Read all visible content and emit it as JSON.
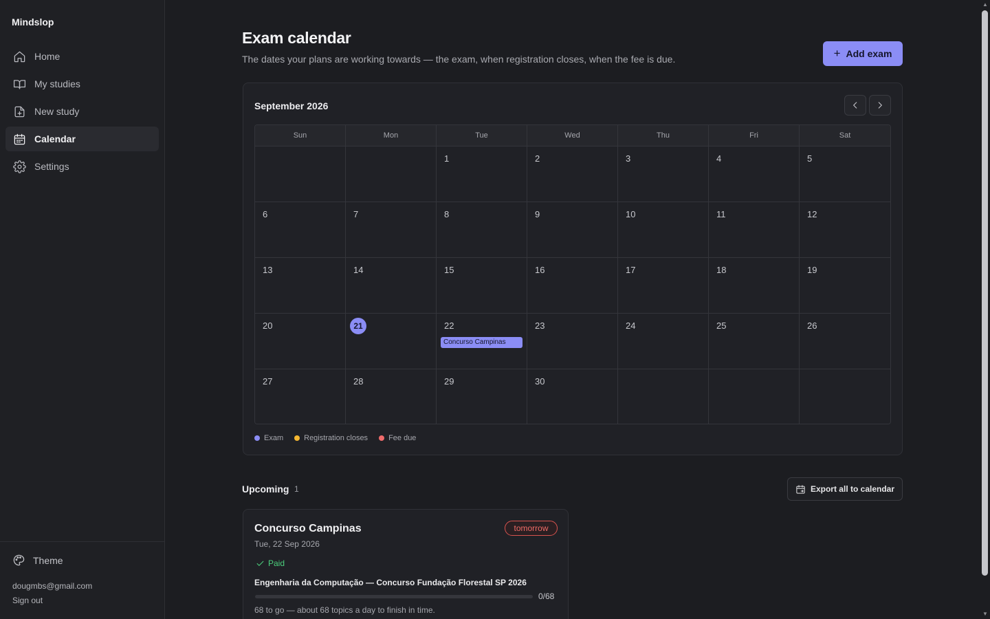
{
  "app": {
    "brand": "Mindslop"
  },
  "sidebar": {
    "items": [
      {
        "label": "Home",
        "icon": "home-icon",
        "active": false
      },
      {
        "label": "My studies",
        "icon": "book-icon",
        "active": false
      },
      {
        "label": "New study",
        "icon": "file-plus-icon",
        "active": false
      },
      {
        "label": "Calendar",
        "icon": "calendar-icon",
        "active": true
      },
      {
        "label": "Settings",
        "icon": "gear-icon",
        "active": false
      }
    ],
    "theme_label": "Theme",
    "user_email": "dougmbs@gmail.com",
    "sign_out": "Sign out"
  },
  "header": {
    "title": "Exam calendar",
    "subtitle": "The dates your plans are working towards — the exam, when registration closes, when the fee is due.",
    "add_button": "Add exam"
  },
  "calendar": {
    "month_label": "September 2026",
    "weekdays": [
      "Sun",
      "Mon",
      "Tue",
      "Wed",
      "Thu",
      "Fri",
      "Sat"
    ],
    "weeks": [
      [
        "",
        "",
        "1",
        "2",
        "3",
        "4",
        "5"
      ],
      [
        "6",
        "7",
        "8",
        "9",
        "10",
        "11",
        "12"
      ],
      [
        "13",
        "14",
        "15",
        "16",
        "17",
        "18",
        "19"
      ],
      [
        "20",
        "21",
        "22",
        "23",
        "24",
        "25",
        "26"
      ],
      [
        "27",
        "28",
        "29",
        "30",
        "",
        "",
        ""
      ]
    ],
    "today": "21",
    "events": [
      {
        "day": "22",
        "label": "Concurso Campinas",
        "kind": "exam"
      }
    ],
    "legend": [
      {
        "label": "Exam",
        "color": "#8b8df5"
      },
      {
        "label": "Registration closes",
        "color": "#f5b731"
      },
      {
        "label": "Fee due",
        "color": "#ef6b6b"
      }
    ]
  },
  "upcoming": {
    "title": "Upcoming",
    "count": "1",
    "export_button": "Export all to calendar",
    "items": [
      {
        "name": "Concurso Campinas",
        "badge": "tomorrow",
        "date": "Tue, 22 Sep 2026",
        "status": "Paid",
        "study": "Engenharia da Computação — Concurso Fundação Florestal SP 2026",
        "progress_text": "0/68",
        "progress_fraction": 0,
        "note": "68 to go — about 68 topics a day to finish in time."
      }
    ]
  },
  "colors": {
    "accent": "#8b8df5",
    "danger": "#ef6b66",
    "success": "#4cd07d"
  }
}
